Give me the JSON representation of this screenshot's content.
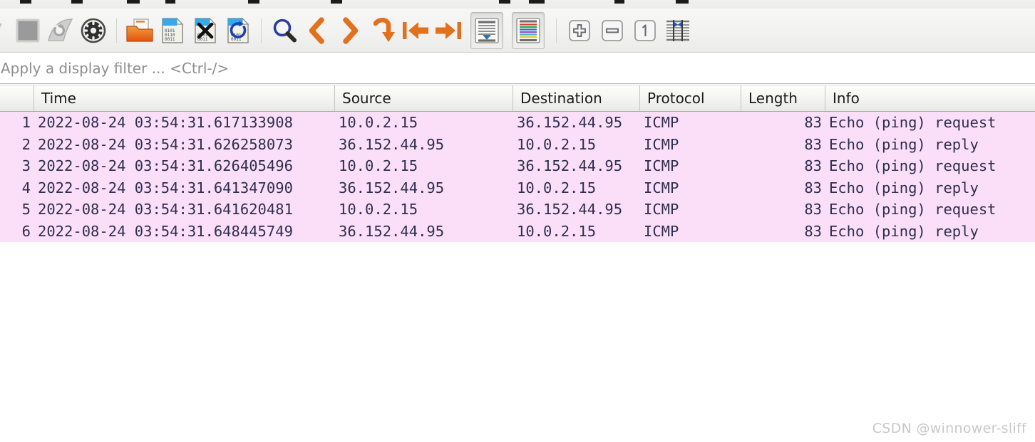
{
  "window": {
    "app": "Wireshark",
    "menu_stub_labels": [
      "",
      "",
      "",
      "",
      "",
      "",
      "",
      "",
      "",
      "",
      ""
    ]
  },
  "toolbar": {
    "buttons": [
      {
        "name": "start-capture-icon",
        "label": "Start capturing packets",
        "state": "cut-off"
      },
      {
        "name": "stop-capture-icon",
        "label": "Stop capturing packets",
        "state": "normal"
      },
      {
        "name": "restart-capture-icon",
        "label": "Restart current capture",
        "state": "disabled"
      },
      {
        "name": "capture-options-icon",
        "label": "Capture options",
        "state": "normal"
      },
      {
        "name": "open-file-icon",
        "label": "Open a capture file",
        "state": "normal"
      },
      {
        "name": "save-file-icon",
        "label": "Save this capture file",
        "state": "normal"
      },
      {
        "name": "close-file-icon",
        "label": "Close this capture file",
        "state": "normal"
      },
      {
        "name": "reload-file-icon",
        "label": "Reload this file",
        "state": "normal"
      },
      {
        "name": "find-packet-icon",
        "label": "Find a packet",
        "state": "normal"
      },
      {
        "name": "go-back-icon",
        "label": "Go back in packet history",
        "state": "normal"
      },
      {
        "name": "go-forward-icon",
        "label": "Go forward in packet history",
        "state": "normal"
      },
      {
        "name": "go-to-packet-icon",
        "label": "Go to the packet",
        "state": "normal"
      },
      {
        "name": "go-first-packet-icon",
        "label": "Go to the first packet",
        "state": "normal"
      },
      {
        "name": "go-last-packet-icon",
        "label": "Go to the last packet",
        "state": "normal"
      },
      {
        "name": "auto-scroll-icon",
        "label": "Auto scroll in live capture",
        "state": "pressed"
      },
      {
        "name": "colorize-packets-icon",
        "label": "Colorize packet list",
        "state": "pressed"
      },
      {
        "name": "zoom-in-icon",
        "label": "Zoom in",
        "state": "normal"
      },
      {
        "name": "zoom-out-icon",
        "label": "Zoom out",
        "state": "normal"
      },
      {
        "name": "zoom-reset-icon",
        "label": "Reset layout to default size",
        "state": "normal"
      },
      {
        "name": "resize-columns-icon",
        "label": "Resize columns to fit contents",
        "state": "normal"
      }
    ]
  },
  "filter": {
    "value": "",
    "placeholder": "Apply a display filter ... <Ctrl-/>"
  },
  "packet_list": {
    "columns": [
      {
        "key": "no",
        "label": "",
        "align": "right"
      },
      {
        "key": "time",
        "label": "Time",
        "align": "left"
      },
      {
        "key": "src",
        "label": "Source",
        "align": "left"
      },
      {
        "key": "dst",
        "label": "Destination",
        "align": "left"
      },
      {
        "key": "proto",
        "label": "Protocol",
        "align": "left"
      },
      {
        "key": "len",
        "label": "Length",
        "align": "right"
      },
      {
        "key": "info",
        "label": "Info",
        "align": "left"
      }
    ],
    "row_color": "#fbdff8",
    "rows": [
      {
        "no": "1",
        "time": "2022-08-24 03:54:31.617133908",
        "src": "10.0.2.15",
        "dst": "36.152.44.95",
        "proto": "ICMP",
        "len": "83",
        "info": "Echo (ping) request"
      },
      {
        "no": "2",
        "time": "2022-08-24 03:54:31.626258073",
        "src": "36.152.44.95",
        "dst": "10.0.2.15",
        "proto": "ICMP",
        "len": "83",
        "info": "Echo (ping) reply"
      },
      {
        "no": "3",
        "time": "2022-08-24 03:54:31.626405496",
        "src": "10.0.2.15",
        "dst": "36.152.44.95",
        "proto": "ICMP",
        "len": "83",
        "info": "Echo (ping) request"
      },
      {
        "no": "4",
        "time": "2022-08-24 03:54:31.641347090",
        "src": "36.152.44.95",
        "dst": "10.0.2.15",
        "proto": "ICMP",
        "len": "83",
        "info": "Echo (ping) reply"
      },
      {
        "no": "5",
        "time": "2022-08-24 03:54:31.641620481",
        "src": "10.0.2.15",
        "dst": "36.152.44.95",
        "proto": "ICMP",
        "len": "83",
        "info": "Echo (ping) request"
      },
      {
        "no": "6",
        "time": "2022-08-24 03:54:31.648445749",
        "src": "36.152.44.95",
        "dst": "10.0.2.15",
        "proto": "ICMP",
        "len": "83",
        "info": "Echo (ping) reply"
      }
    ]
  },
  "watermark": {
    "text": "CSDN @winnower-sliff"
  }
}
